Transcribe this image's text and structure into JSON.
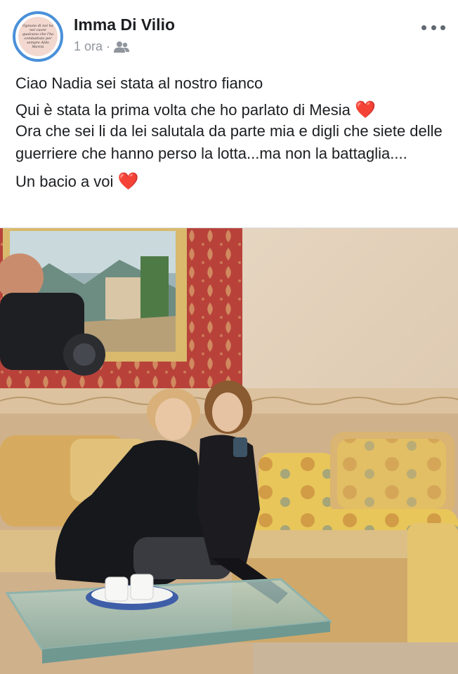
{
  "post": {
    "author": "Imma Di Vilio",
    "time": "1 ora",
    "separator": "·",
    "audience_icon": "friends-icon",
    "more_icon": "more-options-icon",
    "avatar_text": "Ognuno di noi ha nel cuore qualcuno che l'ha combattuto per sempre Aldo Merini",
    "paragraphs": [
      "Ciao Nadia sei stata al nostro fianco",
      "Qui è stata la prima volta che ho parlato di Mesia",
      "Ora che sei li da lei salutala da parte mia e digli che siete delle guerriere che hanno perso la lotta...ma non la battaglia....",
      "Un bacio a voi"
    ],
    "heart_emoji": "❤️",
    "photo_icon": "post-photo"
  },
  "colors": {
    "accent": "#4a90d9",
    "text": "#1c1e21",
    "meta": "#90949c",
    "heart": "#e0242c"
  }
}
